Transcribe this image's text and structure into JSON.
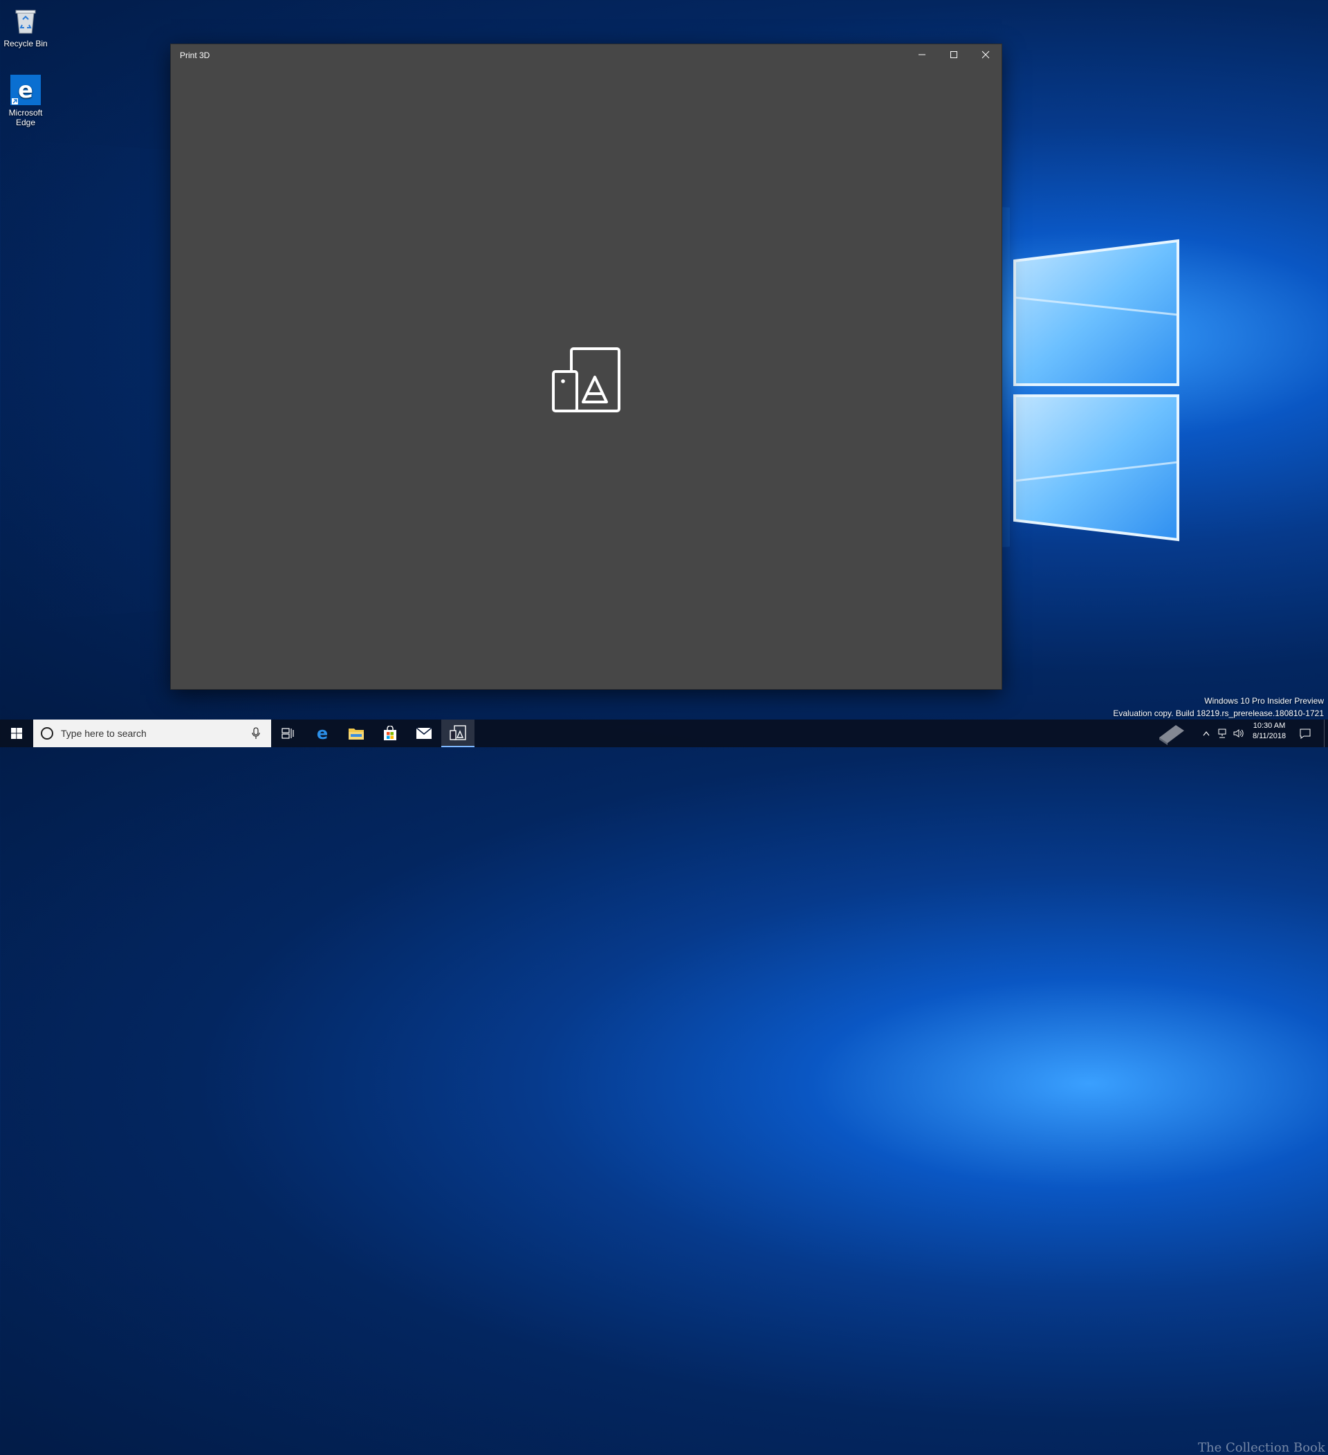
{
  "desktop": {
    "icons": [
      {
        "label": "Recycle Bin",
        "icon": "recycle-bin-icon"
      },
      {
        "label": "Microsoft Edge",
        "icon": "edge-icon"
      }
    ]
  },
  "window": {
    "title": "Print 3D",
    "background": "#474747",
    "controls": {
      "minimize": "minimize-icon",
      "maximize": "maximize-icon",
      "close": "close-icon"
    },
    "splash_icon": "print-3d-logo-icon"
  },
  "taskbar": {
    "search_placeholder": "Type here to search",
    "pinned": [
      "task-view-icon",
      "edge-icon",
      "file-explorer-icon",
      "store-icon",
      "mail-icon",
      "print-3d-icon"
    ],
    "active_app": "print-3d-icon"
  },
  "system": {
    "time": "10:30 AM",
    "date": "8/11/2018",
    "edition": "Windows 10 Pro Insider Preview",
    "build": "Evaluation copy. Build 18219.rs_prerelease.180810-1721",
    "watermark_text": "The Collection Book"
  },
  "colors": {
    "accent": "#0078d7",
    "taskbar": "#081022",
    "window_bg": "#474747"
  }
}
